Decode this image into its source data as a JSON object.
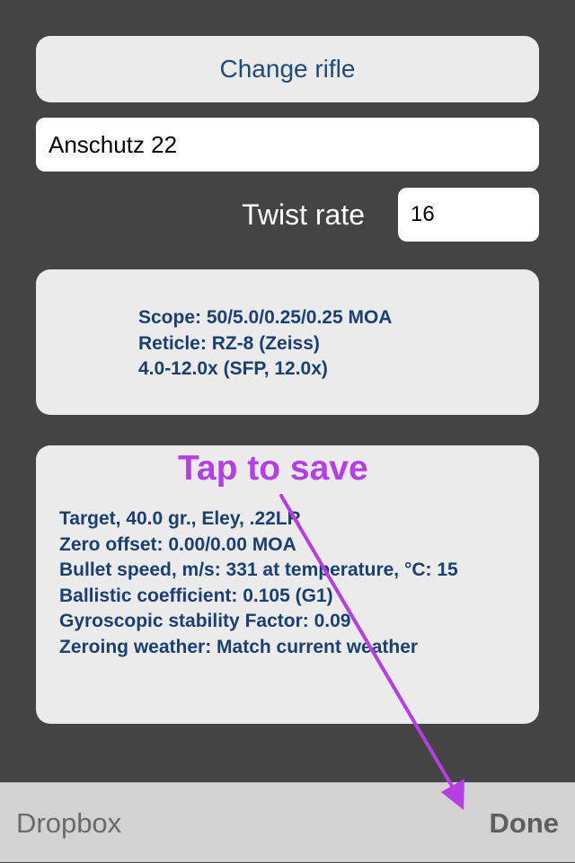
{
  "rifle": {
    "change_button_label": "Change rifle",
    "name_value": "Anschutz 22",
    "twist_rate_label": "Twist rate",
    "twist_rate_value": "16"
  },
  "scope": {
    "lines": [
      "Scope: 50/5.0/0.25/0.25 MOA",
      "Reticle: RZ-8 (Zeiss)",
      "4.0-12.0x (SFP, 12.0x)"
    ]
  },
  "zero": {
    "lines": [
      "Target, 40.0 gr., Eley, .22LR",
      "Zero offset: 0.00/0.00 MOA",
      "Bullet speed, m/s: 331 at temperature, °C: 15",
      "Ballistic coefficient: 0.105 (G1)",
      "Gyroscopic stability Factor: 0.09",
      "Zeroing weather: Match current weather"
    ]
  },
  "annotation": {
    "hint_text": "Tap to save",
    "color": "#b53fe2"
  },
  "toolbar": {
    "dropbox_label": "Dropbox",
    "done_label": "Done"
  },
  "colors": {
    "background": "#444444",
    "card": "#ebebeb",
    "card_text": "#1a3f73",
    "toolbar": "#d2d2d2"
  }
}
